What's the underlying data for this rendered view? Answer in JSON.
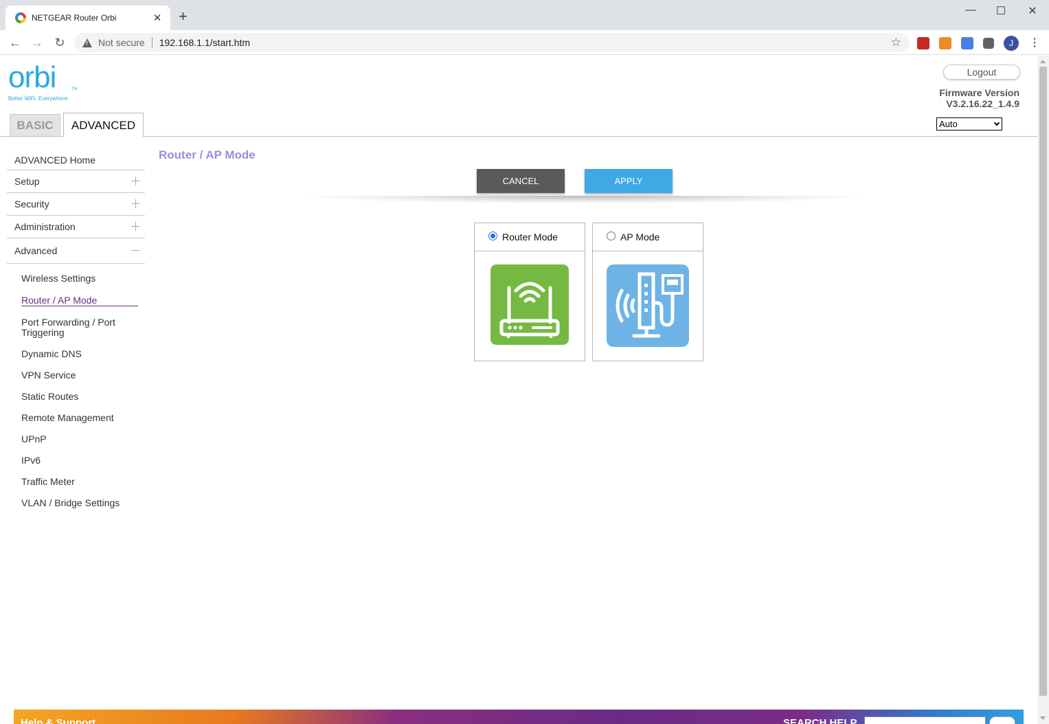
{
  "browser": {
    "tab_title": "NETGEAR Router Orbi",
    "not_secure": "Not secure",
    "url": "192.168.1.1/start.htm",
    "profile_initial": "J"
  },
  "header": {
    "logo_text": "orbi",
    "logo_tm": "TM",
    "tagline": "Better WiFi. Everywhere.",
    "logout": "Logout",
    "firmware_label": "Firmware Version",
    "firmware_value": "V3.2.16.22_1.4.9",
    "language": "Auto",
    "tabs": {
      "basic": "BASIC",
      "advanced": "ADVANCED"
    }
  },
  "sidebar": {
    "items": [
      {
        "label": "ADVANCED Home"
      },
      {
        "label": "Setup"
      },
      {
        "label": "Security"
      },
      {
        "label": "Administration"
      },
      {
        "label": "Advanced"
      }
    ],
    "sub_items": [
      {
        "label": "Wireless Settings"
      },
      {
        "label": "Router / AP Mode"
      },
      {
        "label": "Port Forwarding / Port Triggering"
      },
      {
        "label": "Dynamic DNS"
      },
      {
        "label": "VPN Service"
      },
      {
        "label": "Static Routes"
      },
      {
        "label": "Remote Management"
      },
      {
        "label": "UPnP"
      },
      {
        "label": "IPv6"
      },
      {
        "label": "Traffic Meter"
      },
      {
        "label": "VLAN / Bridge Settings"
      }
    ]
  },
  "main": {
    "title": "Router / AP Mode",
    "cancel": "CANCEL",
    "apply": "APPLY",
    "modes": [
      {
        "label": "Router Mode",
        "selected": true,
        "icon": "router-icon",
        "color": "#75b943"
      },
      {
        "label": "AP Mode",
        "selected": false,
        "icon": "access-point-icon",
        "color": "#6db3e6"
      }
    ]
  },
  "footer": {
    "help": "Help & Support",
    "search_label": "SEARCH HELP"
  },
  "colors": {
    "title": "#9b8ee0",
    "active_nav": "#6b2c7d",
    "apply": "#3fa9e6",
    "cancel": "#5a5a5a"
  }
}
